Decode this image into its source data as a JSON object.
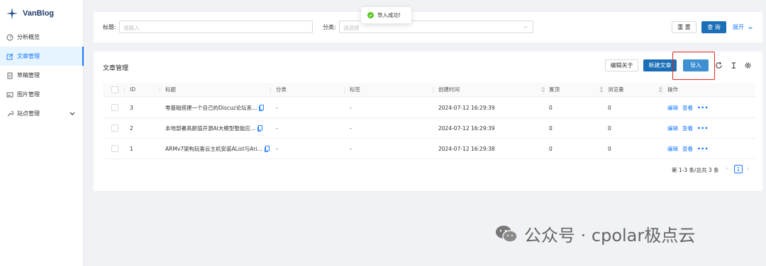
{
  "app": {
    "name": "VanBlog"
  },
  "sidebar": {
    "items": [
      {
        "label": "分析概览",
        "icon": "dashboard-icon"
      },
      {
        "label": "文章管理",
        "icon": "edit-icon",
        "active": true
      },
      {
        "label": "草稿管理",
        "icon": "draft-icon"
      },
      {
        "label": "图片管理",
        "icon": "image-icon"
      },
      {
        "label": "站点管理",
        "icon": "wrench-icon"
      }
    ]
  },
  "filters": {
    "title_label": "标题:",
    "title_placeholder": "请输入",
    "category_label": "分类:",
    "category_placeholder": "请选择",
    "reset_label": "重 置",
    "query_label": "查 询",
    "expand_label": "展开"
  },
  "toast": {
    "message": "导入成功!"
  },
  "table_card": {
    "title": "文章管理",
    "btn_edit_about": "编辑关于",
    "btn_new_article": "新建文章",
    "btn_import": "导入"
  },
  "table": {
    "headers": {
      "id": "ID",
      "title": "标题",
      "category": "分类",
      "tags": "标签",
      "created": "创建时间",
      "top": "置顶",
      "views": "浏览量",
      "actions": "操作"
    },
    "rows": [
      {
        "id": "3",
        "title": "零基础搭建一个自己的Discuz论坛系...",
        "category": "-",
        "tags": "-",
        "created": "2024-07-12 16:29:39",
        "top": "0",
        "views": "0"
      },
      {
        "id": "2",
        "title": "本地部署高颜值开源AI大模型智能应...",
        "category": "-",
        "tags": "-",
        "created": "2024-07-12 16:29:39",
        "top": "0",
        "views": "0"
      },
      {
        "id": "1",
        "title": "ARMv7架构玩客云主机安装AList与Ari...",
        "category": "-",
        "tags": "-",
        "created": "2024-07-12 16:29:38",
        "top": "0",
        "views": "0"
      }
    ],
    "action_edit": "编辑",
    "action_view": "查看",
    "action_more": "•••"
  },
  "pagination": {
    "summary": "第 1-3 条/总共 3 条",
    "current_page": "1"
  },
  "watermark": {
    "text": "公众号 · cpolar极点云"
  },
  "colors": {
    "primary": "#1677ff",
    "highlight": "#e1251b",
    "success": "#52c41a"
  }
}
